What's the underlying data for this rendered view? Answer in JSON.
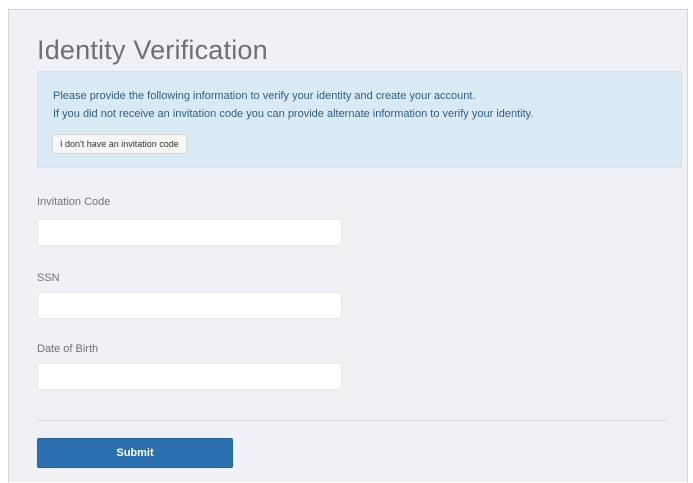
{
  "page": {
    "title": "Identity Verification"
  },
  "info": {
    "line1": "Please provide the following information to verify your identity and create your account.",
    "line2": "If you did not receive an invitation code you can provide alternate information to verify your identity.",
    "no_code_button": "I don't have an invitation code"
  },
  "form": {
    "fields": [
      {
        "label": "Invitation Code",
        "value": ""
      },
      {
        "label": "SSN",
        "value": ""
      },
      {
        "label": "Date of Birth",
        "value": ""
      }
    ],
    "submit_label": "Submit"
  },
  "colors": {
    "panel_background": "#eff1f5",
    "info_background": "#daeaf5",
    "info_text": "#2f5e82",
    "submit_button": "#2a6fb0"
  }
}
